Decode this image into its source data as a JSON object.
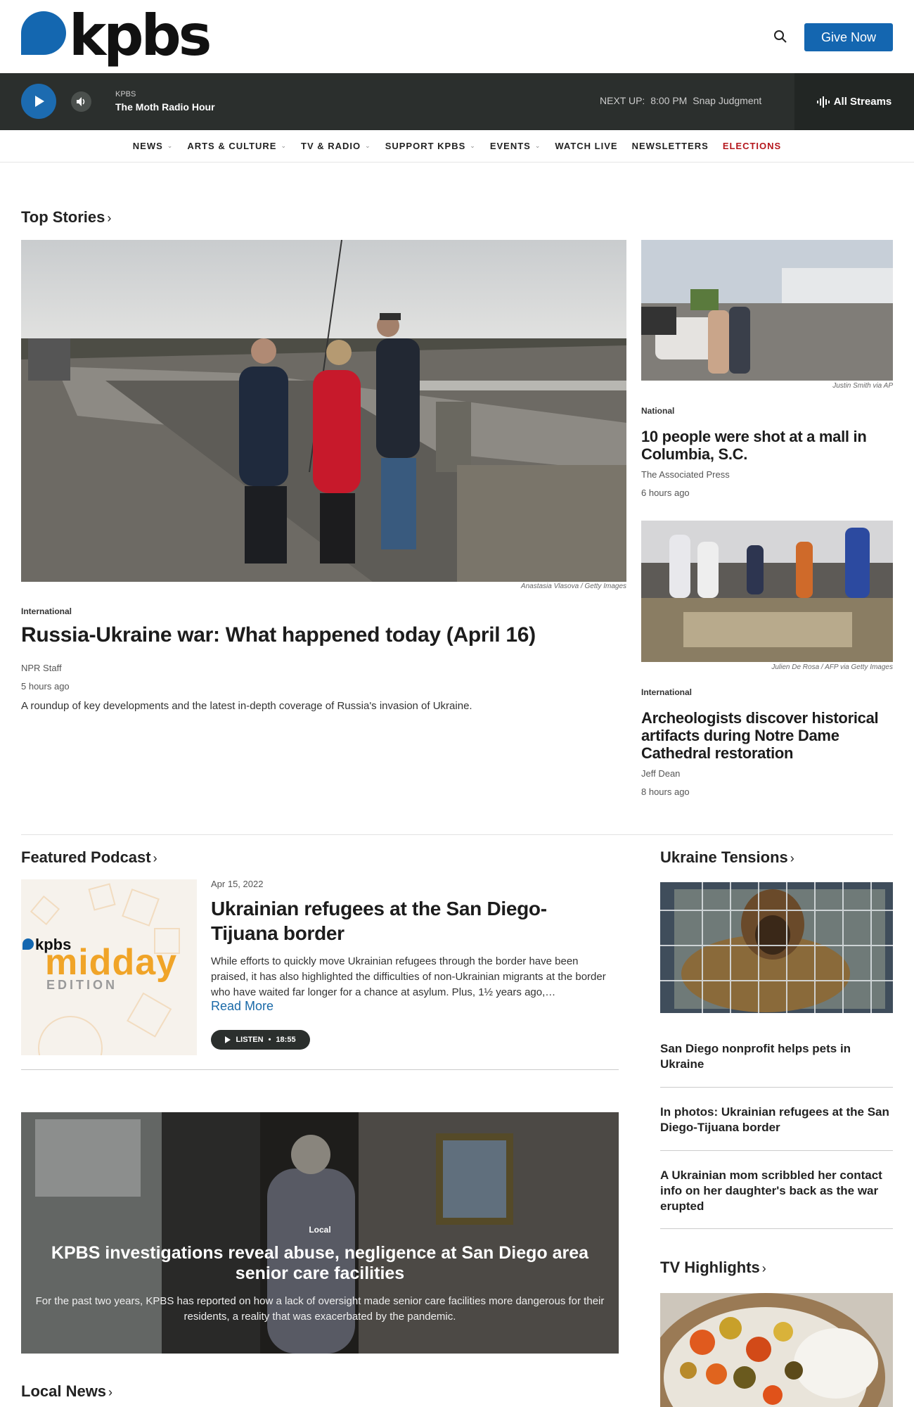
{
  "header": {
    "logo_text": "kpbs",
    "give_label": "Give Now"
  },
  "player": {
    "station": "KPBS",
    "show": "The Moth Radio Hour",
    "next_up_label": "NEXT UP:",
    "next_up_time": "8:00 PM",
    "next_up_show": "Snap Judgment",
    "all_streams": "All Streams"
  },
  "nav": {
    "items": [
      {
        "label": "NEWS",
        "dropdown": true
      },
      {
        "label": "ARTS & CULTURE",
        "dropdown": true
      },
      {
        "label": "TV & RADIO",
        "dropdown": true
      },
      {
        "label": "SUPPORT KPBS",
        "dropdown": true
      },
      {
        "label": "EVENTS",
        "dropdown": true
      },
      {
        "label": "WATCH LIVE",
        "dropdown": false
      },
      {
        "label": "NEWSLETTERS",
        "dropdown": false
      },
      {
        "label": "ELECTIONS",
        "dropdown": false,
        "color": "#b5171d"
      }
    ]
  },
  "top_stories": {
    "title": "Top Stories",
    "lead": {
      "credit_name": "Anastasia Vlasova",
      "credit_agency": "Getty Images",
      "kicker": "International",
      "headline": "Russia-Ukraine war: What happened today (April 16)",
      "author": "NPR Staff",
      "time": "5 hours ago",
      "summary": "A roundup of key developments and the latest in-depth coverage of Russia's invasion of Ukraine."
    },
    "side1": {
      "credit": "Justin Smith via AP",
      "kicker": "National",
      "headline": "10 people were shot at a mall in Columbia, S.C.",
      "author": "The Associated Press",
      "time": "6 hours ago"
    },
    "side2": {
      "credit_name": "Julien De Rosa",
      "credit_agency": "AFP via Getty Images",
      "kicker": "International",
      "headline": "Archeologists discover historical artifacts during Notre Dame Cathedral restoration",
      "author": "Jeff Dean",
      "time": "8 hours ago"
    }
  },
  "featured_podcast": {
    "title": "Featured Podcast",
    "logo_brand": "kpbs",
    "logo_word": "midday",
    "logo_sub": "EDITION",
    "date": "Apr 15, 2022",
    "headline": "Ukrainian refugees at the San Diego-Tijuana border",
    "summary": "While efforts to quickly move Ukrainian refugees through the border have been praised, it has also highlighted the difficulties of non-Ukrainian migrants at the border who have waited far longer for a chance at asylum. Plus, 1½ years ago,…",
    "read_more": "Read More",
    "listen_label": "LISTEN",
    "duration": "18:55"
  },
  "feature": {
    "kicker": "Local",
    "headline": "KPBS investigations reveal abuse, negligence at San Diego area senior care facilities",
    "summary": "For the past two years, KPBS has reported on how a lack of oversight made senior care facilities more dangerous for their residents, a reality that was exacerbated by the pandemic."
  },
  "local_news": {
    "title": "Local News"
  },
  "ukraine": {
    "title": "Ukraine Tensions",
    "links": [
      "San Diego nonprofit helps pets in Ukraine",
      "In photos: Ukrainian refugees at the San Diego-Tijuana border",
      "A Ukrainian mom scribbled her contact info on her daughter's back as the war erupted"
    ]
  },
  "tv": {
    "title": "TV Highlights"
  }
}
